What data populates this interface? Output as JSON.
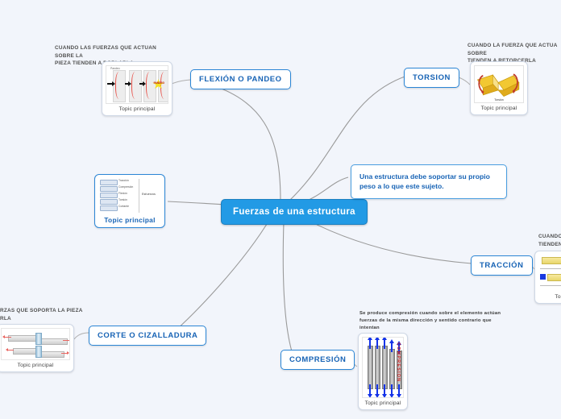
{
  "diagram": {
    "type": "mind-map",
    "background_color": "#f2f5fb",
    "central": {
      "label": "Fuerzas de una estructura",
      "color": "#229ae5"
    },
    "branches": [
      {
        "id": "flexion",
        "label": "FLEXIÓN O PANDEO",
        "annotation": "CUANDO LAS FUERZAS QUE ACTUAN SOBRE LA\nPIEZA TIENDEN A DOBLARLA",
        "card_topic": "Topic principal",
        "image_caption": "Pandeo",
        "image_badge": "PANDEO"
      },
      {
        "id": "torsion",
        "label": "TORSION",
        "annotation": "CUANDO LA FUERZA QUE ACTUA SOBRE\nTIENDEN A RETORCERLA",
        "card_topic": "Topic principal",
        "image_caption": "Torsión"
      },
      {
        "id": "peso",
        "label": "Una estructura debe soportar su propio peso a lo que este sujeto."
      },
      {
        "id": "traccion",
        "label": "TRACCIÓN",
        "annotation": "CUANDO\nTIENDEN",
        "card_topic": "Top"
      },
      {
        "id": "compresion",
        "label": "COMPRESIÓN",
        "annotation": "Se produce compresión cuando sobre el elemento actúan\nfuerzas de la misma dirección y sentido contrario que intentan\na contraerlo.",
        "card_topic": "Topic principal",
        "image_word": "COMPRESION"
      },
      {
        "id": "corte",
        "label": "CORTE O CIZALLADURA",
        "annotation": "RZAS QUE SOPORTA LA PIEZA\nRLA",
        "card_topic": "Topic principal"
      },
      {
        "id": "tabla",
        "card_topic": "Topic principal",
        "table_rows": [
          "Tracción",
          "Compresión",
          "Flexión",
          "Torsión",
          "Cortante"
        ],
        "table_note": "Esfuerzos"
      }
    ],
    "colors": {
      "accent": "#229ae5",
      "pill_border": "#2b86d6",
      "pill_text": "#1763b5",
      "edge": "#9a9a9a"
    }
  }
}
